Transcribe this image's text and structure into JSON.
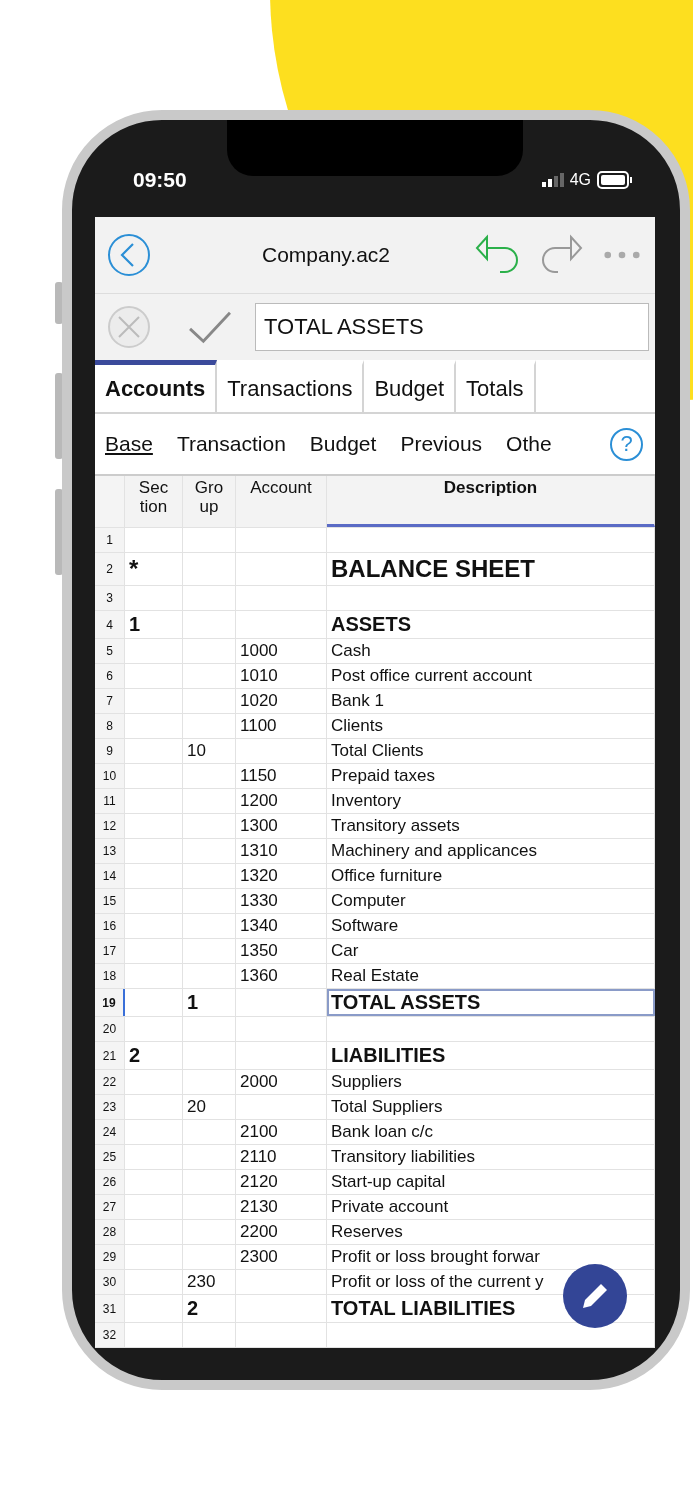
{
  "status_bar": {
    "time": "09:50",
    "network": "4G"
  },
  "toolbar": {
    "title": "Company.ac2"
  },
  "edit_bar": {
    "value": "TOTAL ASSETS"
  },
  "tabs": [
    {
      "label": "Accounts",
      "selected": true
    },
    {
      "label": "Transactions",
      "selected": false
    },
    {
      "label": "Budget",
      "selected": false
    },
    {
      "label": "Totals",
      "selected": false
    }
  ],
  "views": [
    {
      "label": "Base",
      "selected": true
    },
    {
      "label": "Transaction",
      "selected": false
    },
    {
      "label": "Budget",
      "selected": false
    },
    {
      "label": "Previous",
      "selected": false
    },
    {
      "label": "Othe",
      "selected": false
    }
  ],
  "help": "?",
  "table": {
    "columns": [
      {
        "lines": [
          "Sec",
          "tion"
        ]
      },
      {
        "lines": [
          "Gro",
          "up"
        ]
      },
      {
        "lines": [
          "Account"
        ]
      },
      {
        "lines": [
          "Description"
        ],
        "selected": true
      }
    ],
    "rows": [
      {
        "number": "1",
        "kind": "normal",
        "selected": false
      },
      {
        "number": "2",
        "section": "*",
        "description": "BALANCE SHEET",
        "kind": "title",
        "selected": false
      },
      {
        "number": "3",
        "kind": "normal",
        "selected": false
      },
      {
        "number": "4",
        "section": "1",
        "description": "ASSETS",
        "kind": "bold",
        "selected": false
      },
      {
        "number": "5",
        "account": "1000",
        "description": "Cash",
        "kind": "normal",
        "selected": false
      },
      {
        "number": "6",
        "account": "1010",
        "description": "Post office current account",
        "kind": "normal",
        "selected": false
      },
      {
        "number": "7",
        "account": "1020",
        "description": "Bank 1",
        "kind": "normal",
        "selected": false
      },
      {
        "number": "8",
        "account": "1100",
        "description": "Clients",
        "kind": "normal",
        "selected": false
      },
      {
        "number": "9",
        "group": "10",
        "description": "Total Clients",
        "kind": "normal",
        "selected": false
      },
      {
        "number": "10",
        "account": "1150",
        "description": "Prepaid taxes",
        "kind": "normal",
        "selected": false
      },
      {
        "number": "11",
        "account": "1200",
        "description": "Inventory",
        "kind": "normal",
        "selected": false
      },
      {
        "number": "12",
        "account": "1300",
        "description": "Transitory assets",
        "kind": "normal",
        "selected": false
      },
      {
        "number": "13",
        "account": "1310",
        "description": "Machinery and applicances",
        "kind": "normal",
        "selected": false
      },
      {
        "number": "14",
        "account": "1320",
        "description": "Office furniture",
        "kind": "normal",
        "selected": false
      },
      {
        "number": "15",
        "account": "1330",
        "description": "Computer",
        "kind": "normal",
        "selected": false
      },
      {
        "number": "16",
        "account": "1340",
        "description": "Software",
        "kind": "normal",
        "selected": false
      },
      {
        "number": "17",
        "account": "1350",
        "description": "Car",
        "kind": "normal",
        "selected": false
      },
      {
        "number": "18",
        "account": "1360",
        "description": "Real Estate",
        "kind": "normal",
        "selected": false
      },
      {
        "number": "19",
        "group": "1",
        "description": "TOTAL ASSETS",
        "kind": "bold",
        "selected": true
      },
      {
        "number": "20",
        "kind": "normal",
        "selected": false
      },
      {
        "number": "21",
        "section": "2",
        "description": "LIABILITIES",
        "kind": "bold",
        "selected": false
      },
      {
        "number": "22",
        "account": "2000",
        "description": "Suppliers",
        "kind": "normal",
        "selected": false
      },
      {
        "number": "23",
        "group": "20",
        "description": "Total Suppliers",
        "kind": "normal",
        "selected": false
      },
      {
        "number": "24",
        "account": "2100",
        "description": "Bank loan c/c",
        "kind": "normal",
        "selected": false
      },
      {
        "number": "25",
        "account": "2110",
        "description": "Transitory liabilities",
        "kind": "normal",
        "selected": false
      },
      {
        "number": "26",
        "account": "2120",
        "description": "Start-up capital",
        "kind": "normal",
        "selected": false
      },
      {
        "number": "27",
        "account": "2130",
        "description": "Private account",
        "kind": "normal",
        "selected": false
      },
      {
        "number": "28",
        "account": "2200",
        "description": "Reserves",
        "kind": "normal",
        "selected": false
      },
      {
        "number": "29",
        "account": "2300",
        "description": "Profit or loss brought forwar",
        "kind": "normal",
        "selected": false
      },
      {
        "number": "30",
        "group": "230",
        "description": "Profit or loss of the current y",
        "kind": "normal",
        "selected": false
      },
      {
        "number": "31",
        "group": "2",
        "description": "TOTAL LIABILITIES",
        "kind": "bold",
        "selected": false
      },
      {
        "number": "32",
        "kind": "normal",
        "selected": false
      }
    ]
  }
}
